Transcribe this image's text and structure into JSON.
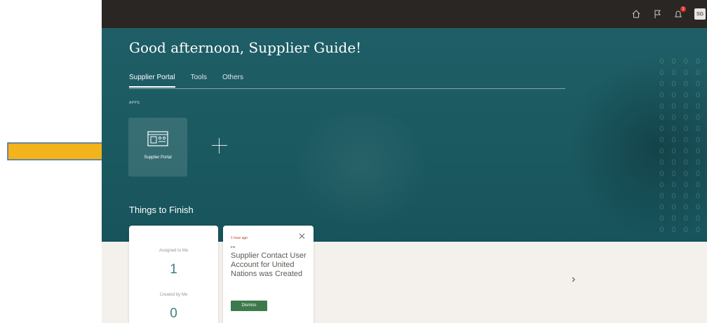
{
  "header": {
    "avatar_initials": "SG",
    "notification_count": "1",
    "icons": [
      "home-icon",
      "flag-icon",
      "notifications-icon"
    ]
  },
  "greeting": "Good afternoon, Supplier Guide!",
  "tabs": [
    {
      "label": "Supplier Portal",
      "active": true
    },
    {
      "label": "Tools",
      "active": false
    },
    {
      "label": "Others",
      "active": false
    }
  ],
  "apps": {
    "section_label": "APPS",
    "tiles": [
      {
        "label": "Supplier Portal",
        "icon": "supplier-portal-icon"
      }
    ]
  },
  "things_to_finish": {
    "title": "Things to Finish",
    "assigned_label": "Assigned to Me",
    "assigned_count": "1",
    "created_label": "Created by Me",
    "created_count": "0",
    "notification": {
      "time": "1 hour ago",
      "tag": "FYI",
      "message": "Supplier Contact User Account for United Nations was Created",
      "dismiss_label": "Dismiss"
    }
  },
  "colors": {
    "hero": "#1b5960",
    "topbar": "#2a2623",
    "accent_count": "#3f7f86",
    "dismiss_button": "#3c7a4c",
    "arrow": "#f3b31b"
  }
}
